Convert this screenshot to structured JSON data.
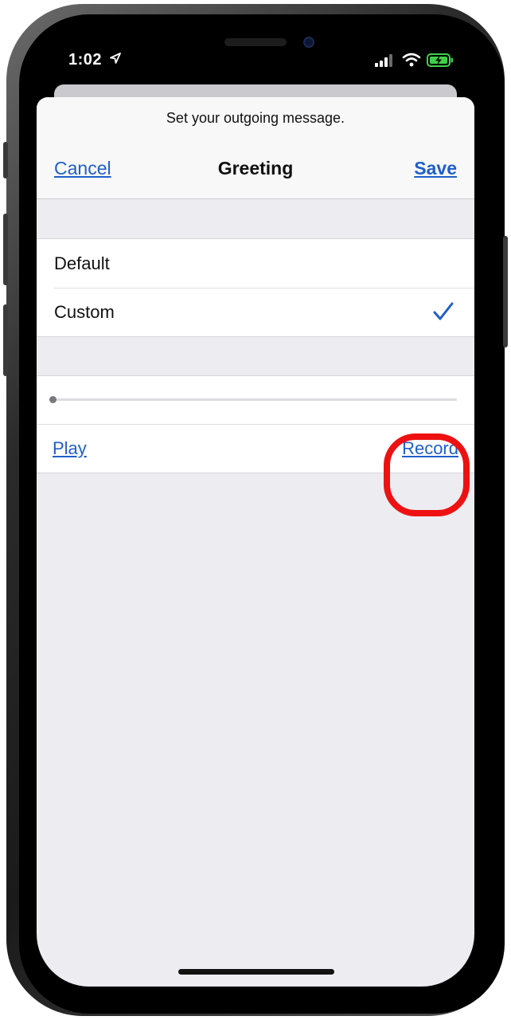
{
  "status_bar": {
    "time": "1:02"
  },
  "header": {
    "prompt": "Set your outgoing message.",
    "cancel_label": "Cancel",
    "title": "Greeting",
    "save_label": "Save"
  },
  "greeting_options": [
    {
      "label": "Default",
      "selected": false
    },
    {
      "label": "Custom",
      "selected": true
    }
  ],
  "playback": {
    "progress": 0,
    "play_label": "Play",
    "record_label": "Record"
  },
  "colors": {
    "accent": "#1f5fc9",
    "highlight": "#ee1111",
    "background": "#ececf1"
  },
  "icons": [
    "location-arrow-icon",
    "cellular-signal-icon",
    "wifi-icon",
    "battery-charging-icon",
    "checkmark-icon"
  ]
}
